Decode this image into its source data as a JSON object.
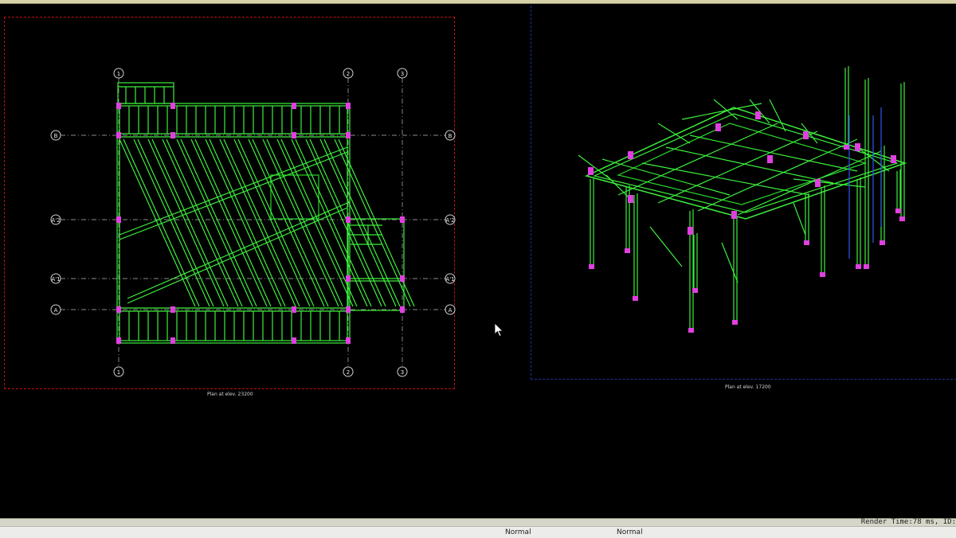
{
  "viewports": {
    "plan": {
      "label": "Plan at elev. 23200"
    },
    "model3d": {
      "label": "Plan at elev. 17200"
    }
  },
  "grid": {
    "columns": [
      "1",
      "2",
      "3"
    ],
    "rows": [
      "B",
      "A'2",
      "A'1",
      "A"
    ]
  },
  "status": {
    "render_time": "Render Time:78 ms, ID:",
    "mode_left": "Normal",
    "mode_right": "Normal"
  },
  "colors": {
    "member": "#3cf03c",
    "joint": "#e040e0",
    "grid": "#b8b8b8",
    "border_plan": "#c01010",
    "border_3d": "#1d2f9a"
  }
}
